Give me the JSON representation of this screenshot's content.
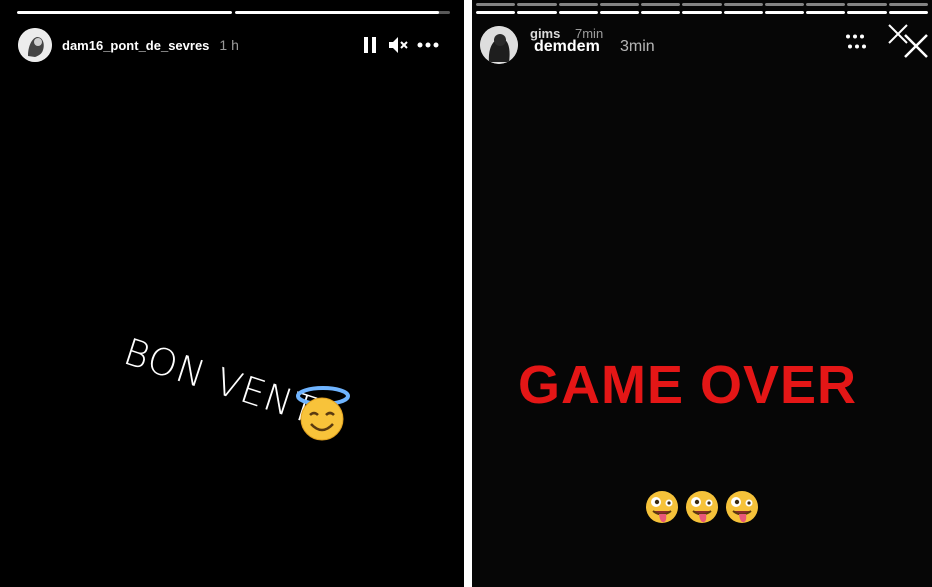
{
  "left_story": {
    "username": "dam16_pont_de_sevres",
    "time": "1 h",
    "caption": "BON VENT",
    "caption_emoji": "smiling-face-with-halo-icon",
    "progress": [
      1.0,
      0.95
    ],
    "controls": [
      "pause-icon",
      "mute-icon",
      "more-icon"
    ]
  },
  "right_story": {
    "username_back": "gims",
    "time_back": "7min",
    "username": "demdem",
    "time": "3min",
    "headline": "GAME OVER",
    "emojis": [
      "zany-face-icon",
      "zany-face-icon",
      "zany-face-icon"
    ],
    "progress_segments": 11,
    "controls": [
      "more-icon",
      "close-icon"
    ]
  },
  "colors": {
    "headline": "#e41616",
    "background": "#000000",
    "divider": "#ffffff"
  }
}
